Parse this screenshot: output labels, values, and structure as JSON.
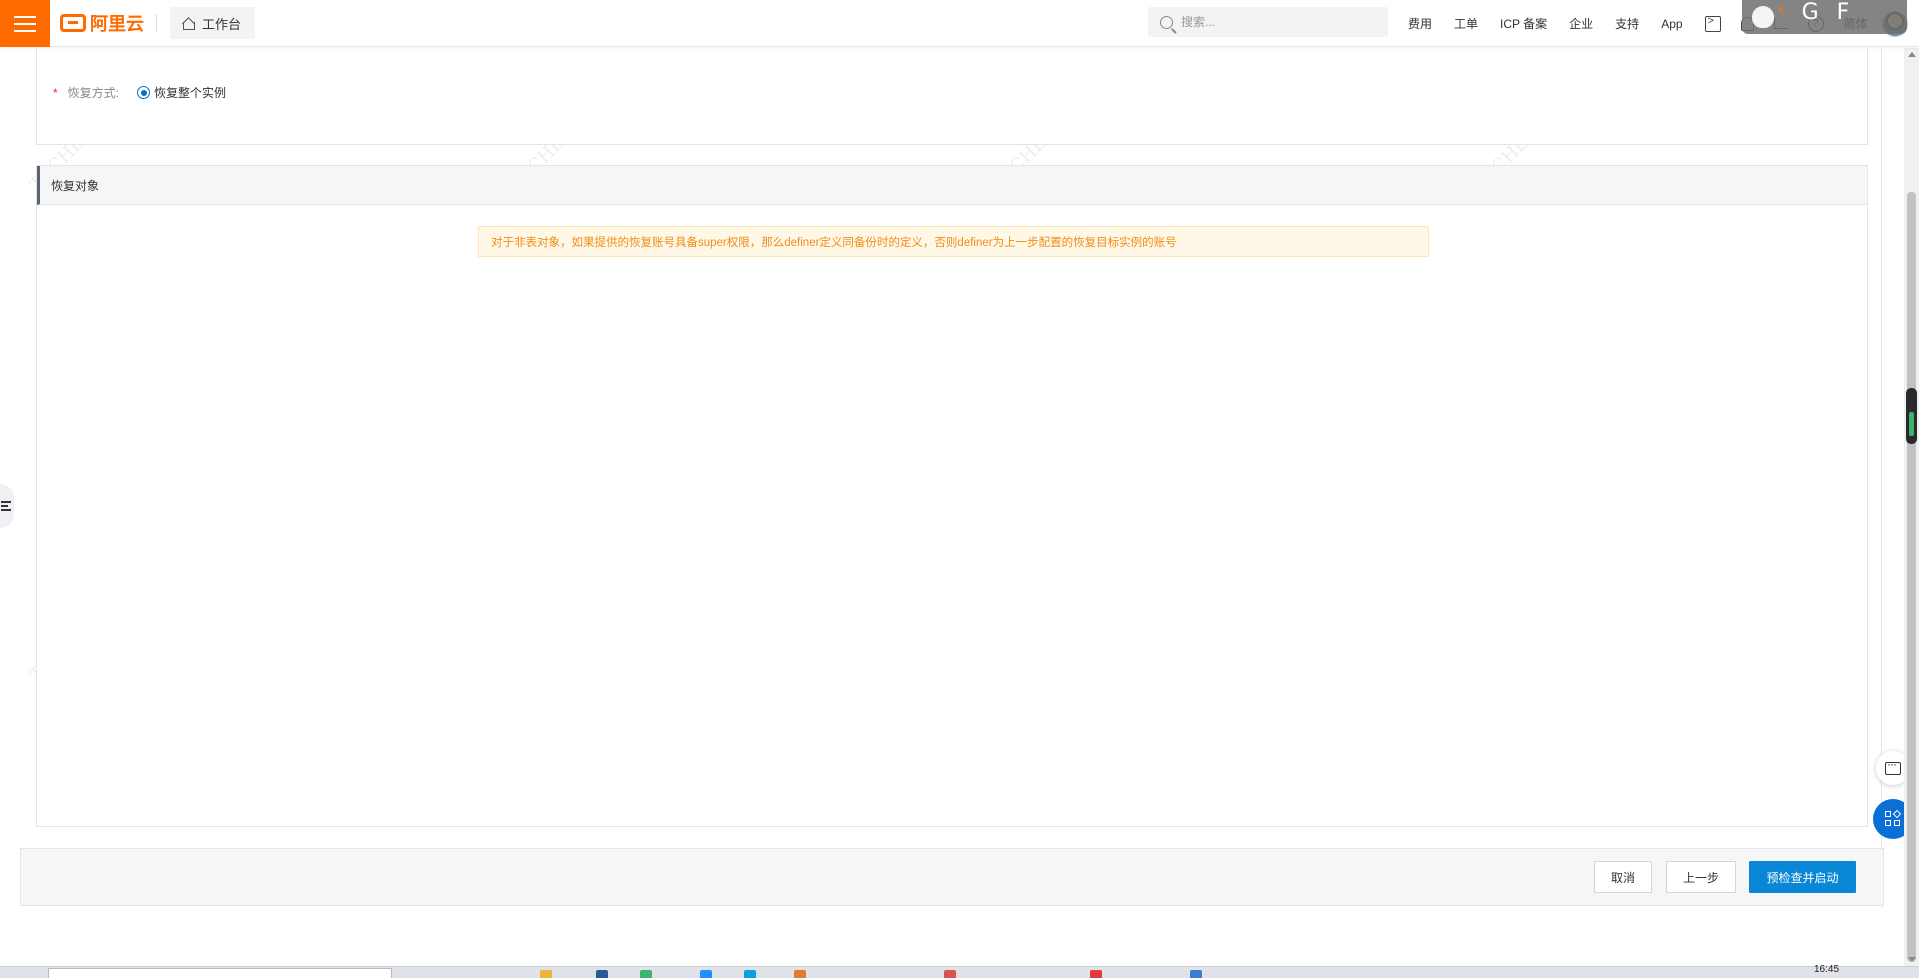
{
  "header": {
    "logo_text": "阿里云",
    "workbench_label": "工作台",
    "search_placeholder": "搜索...",
    "nav": {
      "fees": "费用",
      "tickets": "工单",
      "icp": "ICP 备案",
      "enterprise": "企业",
      "support": "支持",
      "app": "App"
    },
    "language": "简体",
    "overlay": {
      "badge": "4",
      "letter_g": "G",
      "letter_f": "F"
    }
  },
  "form": {
    "restore_mode_required": "*",
    "restore_mode_label": "恢复方式:",
    "restore_mode_option": "恢复整个实例"
  },
  "restore_objects": {
    "title": "恢复对象",
    "notice": "对于非表对象，如果提供的恢复账号具备super权限，那么definer定义同备份时的定义，否则definer为上一步配置的恢复目标实例的账号"
  },
  "footer": {
    "cancel_label": "取消",
    "prev_label": "上一步",
    "start_label": "预检查并启动"
  },
  "watermarks": {
    "text_a": "TECHLEX 李光升",
    "text_b": "（蒋海涛）"
  },
  "taskbar": {
    "clock": "16:45"
  },
  "colors": {
    "brand_orange": "#ff6a00",
    "primary_blue": "#0a86d6",
    "notice_text": "#f08c1c",
    "notice_bg": "#fff8e6"
  }
}
